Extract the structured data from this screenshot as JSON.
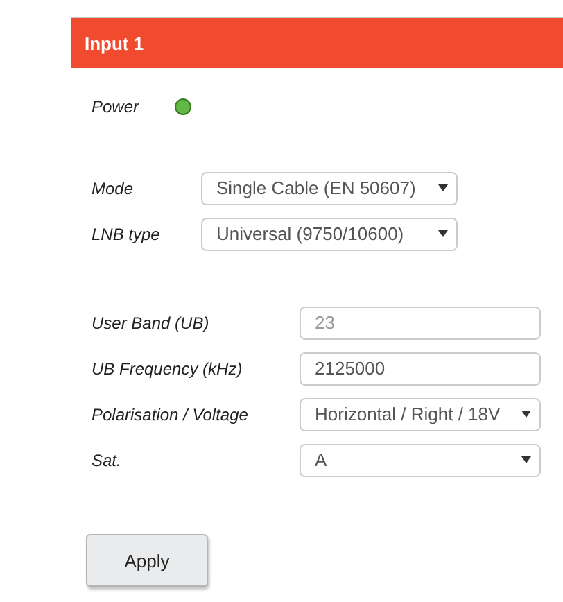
{
  "header": {
    "title": "Input 1"
  },
  "power": {
    "label": "Power",
    "on": true
  },
  "groups": [
    {
      "fields": [
        {
          "label": "Mode",
          "kind": "select",
          "value": "Single Cable (EN 50607)",
          "disabled": false
        },
        {
          "label": "LNB type",
          "kind": "select",
          "value": "Universal (9750/10600)",
          "disabled": false
        }
      ]
    },
    {
      "fields": [
        {
          "label": "User Band (UB)",
          "kind": "input",
          "value": "23",
          "disabled": true
        },
        {
          "label": "UB Frequency (kHz)",
          "kind": "input",
          "value": "2125000",
          "disabled": false
        },
        {
          "label": "Polarisation / Voltage",
          "kind": "select",
          "value": "Horizontal / Right / 18V",
          "disabled": false
        },
        {
          "label": "Sat.",
          "kind": "select",
          "value": "A",
          "disabled": false
        }
      ]
    }
  ],
  "apply_button": "Apply"
}
